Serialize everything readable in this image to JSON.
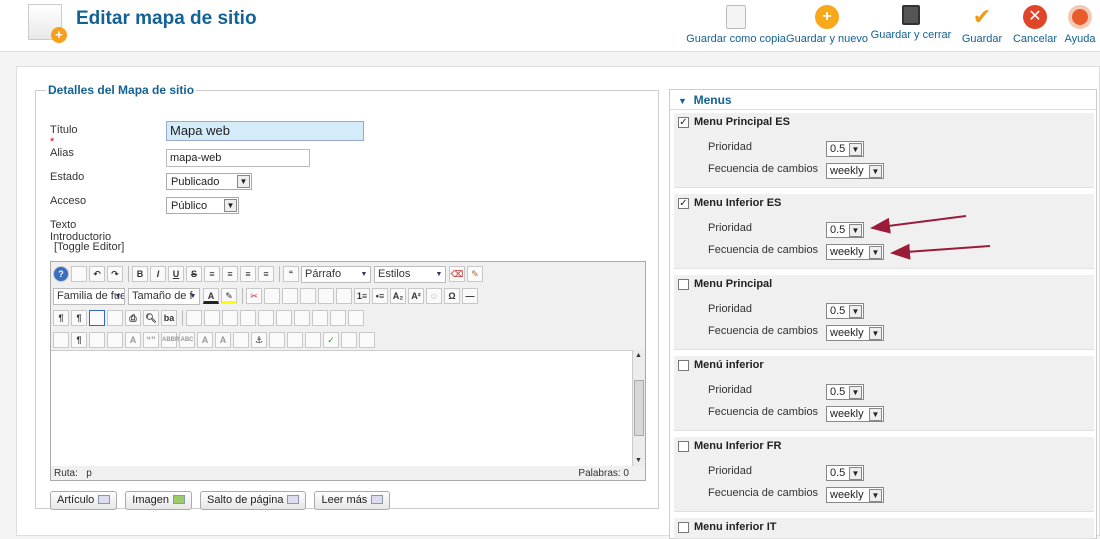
{
  "header": {
    "title": "Editar mapa de sitio",
    "toolbar": {
      "save_copy": "Guardar como copia",
      "save_new": "Guardar y nuevo",
      "save_close": "Guardar y cerrar",
      "save": "Guardar",
      "cancel": "Cancelar",
      "help": "Ayuda"
    }
  },
  "details": {
    "legend": "Detalles del Mapa de sitio",
    "title_label": "Título",
    "title_value": "Mapa web",
    "alias_label": "Alias",
    "alias_value": "mapa-web",
    "state_label": "Estado",
    "state_value": "Publicado",
    "access_label": "Acceso",
    "access_value": "Público",
    "intro_label": "Texto Introductorio",
    "toggle_editor": "[Toggle Editor]"
  },
  "editor": {
    "format_value": "Párrafo",
    "styles_value": "Estilos",
    "font_family": "Familia de fue",
    "font_size": "Tamaño de f",
    "path_label": "Ruta:",
    "path_value": "p",
    "words_label": "Palabras: 0",
    "insert_buttons": [
      "Artículo",
      "Imagen",
      "Salto de página",
      "Leer más"
    ]
  },
  "menus": {
    "heading": "Menus",
    "priority_label": "Prioridad",
    "frequency_label": "Fecuencia de cambios",
    "items": [
      {
        "name": "Menu Principal ES",
        "checked": true,
        "priority": "0.5",
        "frequency": "weekly"
      },
      {
        "name": "Menu Inferior ES",
        "checked": true,
        "priority": "0.5",
        "frequency": "weekly"
      },
      {
        "name": "Menu Principal",
        "checked": false,
        "priority": "0.5",
        "frequency": "weekly"
      },
      {
        "name": "Menú inferior",
        "checked": false,
        "priority": "0.5",
        "frequency": "weekly"
      },
      {
        "name": "Menu Inferior FR",
        "checked": false,
        "priority": "0.5",
        "frequency": "weekly"
      },
      {
        "name": "Menu inferior IT",
        "checked": false,
        "priority": "",
        "frequency": ""
      }
    ]
  },
  "colors": {
    "brand_blue": "#146295",
    "annotation_arrow": "#9b1b3b"
  }
}
